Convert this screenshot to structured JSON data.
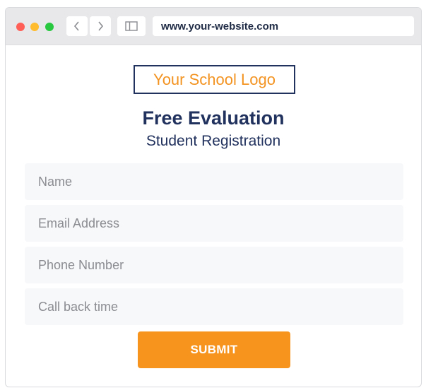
{
  "browser": {
    "url": "www.your-website.com",
    "controls": {
      "close_color": "#ff5f57",
      "minimize_color": "#febc2e",
      "maximize_color": "#28c840"
    },
    "icons": [
      "chevron-left-icon",
      "chevron-right-icon",
      "sidebar-icon"
    ]
  },
  "page": {
    "logo_text": "Your School Logo",
    "title": "Free Evaluation",
    "subtitle": "Student Registration",
    "form": {
      "name_placeholder": "Name",
      "email_placeholder": "Email Address",
      "phone_placeholder": "Phone Number",
      "callback_placeholder": "Call back time",
      "submit_label": "SUBMIT"
    },
    "colors": {
      "accent": "#f7941e",
      "navy": "#22325e",
      "field_bg": "#f7f8fa"
    }
  }
}
